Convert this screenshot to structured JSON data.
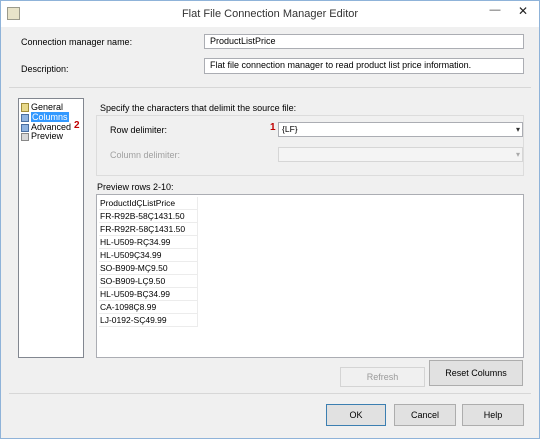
{
  "window": {
    "title": "Flat File Connection Manager Editor",
    "minimize": "—",
    "close": "✕"
  },
  "form": {
    "conn_label": "Connection manager name:",
    "conn_value": "ProductListPrice",
    "desc_label": "Description:",
    "desc_value": "Flat file connection manager to read product list price information."
  },
  "nav": {
    "items": [
      {
        "label": "General"
      },
      {
        "label": "Columns",
        "selected": true
      },
      {
        "label": "Advanced"
      },
      {
        "label": "Preview"
      }
    ],
    "annotation": "2"
  },
  "columns_page": {
    "heading": "Specify the characters that delimit the source file:",
    "row_delim_label": "Row delimiter:",
    "row_delim_value": "{LF}",
    "row_annotation": "1",
    "col_delim_label": "Column delimiter:",
    "col_delim_value": "",
    "preview_label": "Preview rows 2-10:",
    "preview_rows": [
      "ProductIdÇListPrice",
      "FR-R92B-58Ç1431.50",
      "FR-R92R-58Ç1431.50",
      "HL-U509-RÇ34.99",
      "HL-U509Ç34.99",
      "SO-B909-MÇ9.50",
      "SO-B909-LÇ9.50",
      "HL-U509-BÇ34.99",
      "CA-1098Ç8.99",
      "LJ-0192-SÇ49.99"
    ],
    "refresh_label": "Refresh",
    "reset_label": "Reset Columns"
  },
  "buttons": {
    "ok": "OK",
    "cancel": "Cancel",
    "help": "Help"
  },
  "colors": {
    "selection": "#3399ff",
    "annotation": "#c00000",
    "border": "#abadb3"
  }
}
